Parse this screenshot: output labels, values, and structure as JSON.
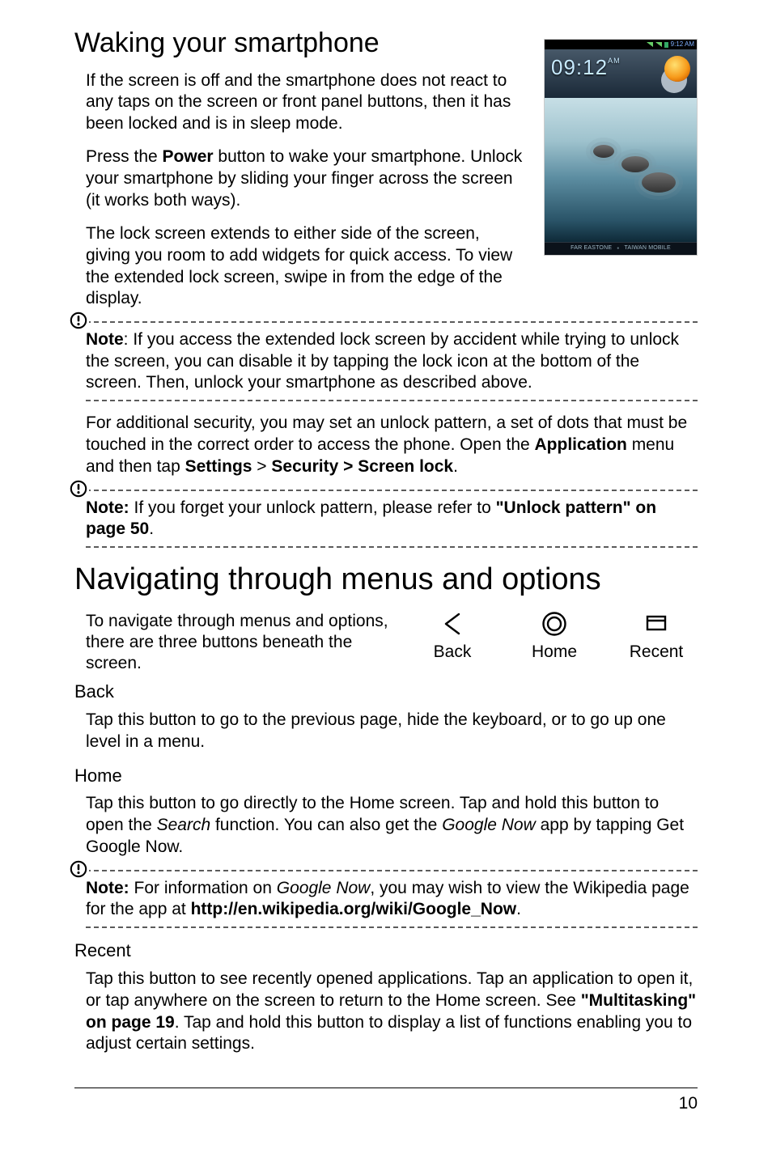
{
  "waking": {
    "heading": "Waking your smartphone",
    "p1": "If the screen is off and the smartphone does not react to any taps on the screen or front panel buttons, then it has been locked and is in sleep mode.",
    "p2_a": "Press the ",
    "p2_power": "Power",
    "p2_b": " button to wake your smartphone. Unlock your smartphone by sliding your finger across the screen (it works both ways).",
    "p3": "The lock screen extends to either side of the screen, giving you room to add widgets for quick access. To view the extended lock screen, swipe in from the edge of the display.",
    "note1_label": "Note",
    "note1_body": ": If you access the extended lock screen by accident while trying to unlock the screen, you can disable it by tapping the lock icon at the bottom of the screen. Then, unlock your smartphone as described above.",
    "p4_a": "For additional security, you may set an unlock pattern, a set of dots that must be touched in the correct order to access the phone. Open the ",
    "p4_app": "Application",
    "p4_b": " menu and then tap ",
    "p4_settings": "Settings",
    "p4_gt": " > ",
    "p4_sec": "Security > Screen lock",
    "p4_c": ".",
    "note2_label": "Note:",
    "note2_a": " If you forget your unlock pattern, please refer to ",
    "note2_ref": "\"Unlock pattern\" on page 50",
    "note2_b": "."
  },
  "navigating": {
    "heading": "Navigating through menus and options",
    "intro": "To navigate through menus and options, there are three buttons beneath the screen.",
    "back_label": "Back",
    "home_label": "Home",
    "recent_label": "Recent",
    "back_head": "Back",
    "back_body": "Tap this button to go to the previous page, hide the keyboard, or to go up one level in a menu.",
    "home_head": "Home",
    "home_body_a": "Tap this button to go directly to the Home screen. Tap and hold this button to open the ",
    "home_body_search": "Search",
    "home_body_b": " function. You can also get the ",
    "home_body_gnow": "Google Now",
    "home_body_c": " app by tapping Get Google Now.",
    "note3_label": "Note:",
    "note3_a": " For information on ",
    "note3_gn": "Google Now",
    "note3_b": ", you may wish to view the Wikipedia page for the app at ",
    "note3_url": "http://en.wikipedia.org/wiki/Google_Now",
    "note3_c": ".",
    "recent_head": "Recent",
    "recent_body_a": "Tap this button to see recently opened applications. Tap an application to open it, or tap anywhere on the screen to return to the Home screen. See ",
    "recent_ref": "\"Multitasking\" on page 19",
    "recent_body_b": ". Tap and hold this button to display a list of functions enabling you to adjust certain settings."
  },
  "lockscreen": {
    "time": "09:12",
    "ampm": "AM",
    "status_time": "9:12 AM",
    "carrier_a": "FAR EASTONE",
    "carrier_b": "TAIWAN MOBILE"
  },
  "footer": {
    "page": "10"
  }
}
